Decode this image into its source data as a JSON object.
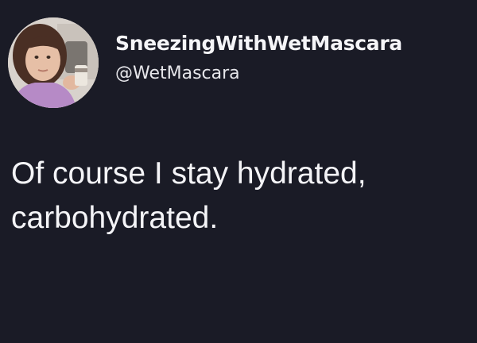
{
  "tweet": {
    "author": {
      "display_name": "SneezingWithWetMascara",
      "handle": "@WetMascara",
      "avatar": "profile-photo-avatar"
    },
    "text_lines": [
      "Of course I stay hydrated,",
      "carbohydrated."
    ]
  },
  "colors": {
    "background": "#1a1b26",
    "text": "#f4f4f7"
  }
}
